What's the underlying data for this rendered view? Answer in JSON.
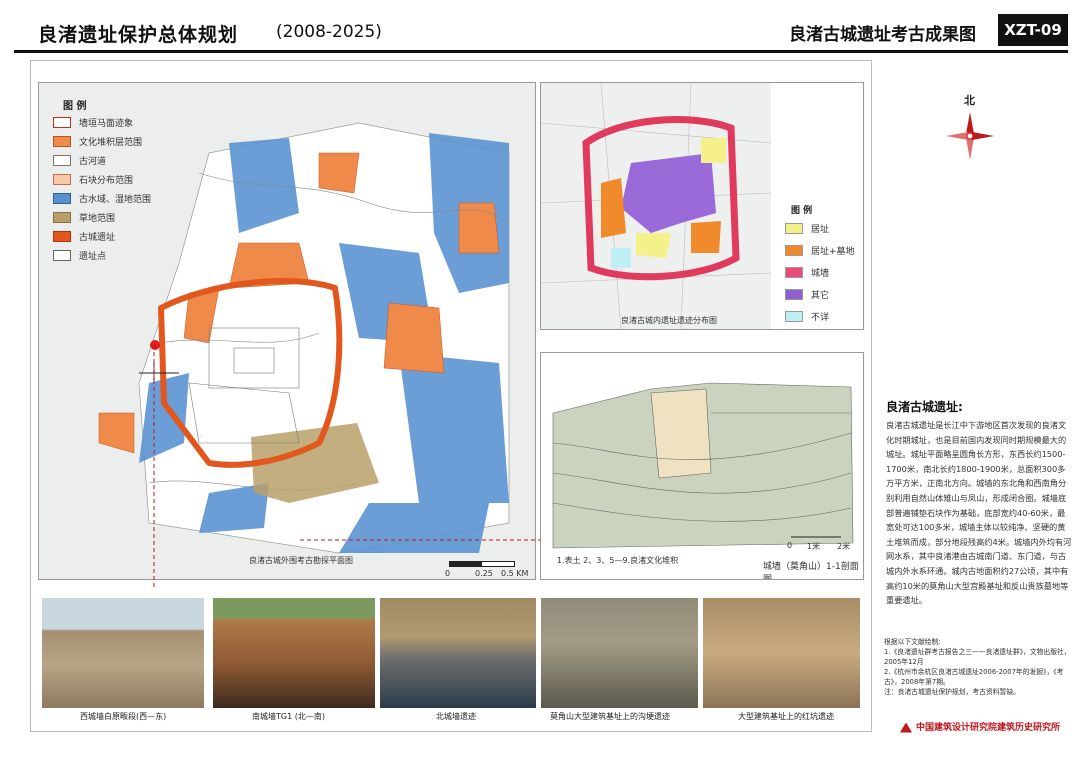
{
  "header": {
    "title": "良渚遗址保护总体规划",
    "years": "(2008-2025)",
    "subtitle": "良渚古城遗址考古成果图",
    "code": "XZT-09"
  },
  "main_map": {
    "legend_title": "图 例",
    "legend": [
      {
        "label": "墙垣马面迹象",
        "color": "#ffffff",
        "border": "#c03020"
      },
      {
        "label": "文化堆积层范围",
        "color": "#f08a4b",
        "border": "#c05020"
      },
      {
        "label": "古河道",
        "color": "#ffffff",
        "border": "#777777"
      },
      {
        "label": "石块分布范围",
        "color": "#f6c8a8",
        "border": "#c07050"
      },
      {
        "label": "古水域、湿地范围",
        "color": "#5a8fd0",
        "border": "#2a5fa0"
      },
      {
        "label": "草地范围",
        "color": "#b9a06a",
        "border": "#8a7040"
      },
      {
        "label": "古城遗址",
        "color": "#e2571e",
        "border": "#b03010"
      },
      {
        "label": "遗址点",
        "color": "#ffffff",
        "border": "#666666"
      }
    ],
    "caption": "良渚古城外围考古勘探平面图",
    "scale": [
      "0",
      "0.25",
      "0.5 KM"
    ]
  },
  "inner_map": {
    "caption": "良渚古城内遗址遗迹分布图",
    "legend_title": "图 例",
    "legend": [
      {
        "label": "居址",
        "color": "#f4f08a"
      },
      {
        "label": "居址+墓地",
        "color": "#f08a2a"
      },
      {
        "label": "城墙",
        "color": "#ec4a78"
      },
      {
        "label": "其它",
        "color": "#9060d0"
      },
      {
        "label": "不详",
        "color": "#bfeff2"
      }
    ]
  },
  "section": {
    "caption": "城墙（莫角山）1-1剖面图",
    "note": "1.表土  2、3、5—9.良渚文化堆积",
    "scale": [
      "0",
      "1米",
      "2米"
    ]
  },
  "photos": [
    {
      "caption": "西城墙白原畈段(西—东)"
    },
    {
      "caption": "南城墙TG1 (北—南)"
    },
    {
      "caption": "北城墙遗迹"
    },
    {
      "caption": "莫角山大型建筑基址上的沟埂遗迹"
    },
    {
      "caption": "大型建筑基址上的红坑遗迹"
    }
  ],
  "compass": {
    "label": "北"
  },
  "description": {
    "title": "良渚古城遗址:",
    "text": "良渚古城遗址是长江中下游地区首次发现的良渚文化时期城址，也是目前国内发现同时期规模最大的城址。城址平面略呈圆角长方形，东西长约1500-1700米，南北长约1800-1900米，总面积300多万平方米，正南北方向。城墙的东北角和西南角分别利用自然山体雉山与凤山，形成闭合圈。城墙底部普遍铺垫石块作为基础，底部宽约40-60米，最宽处可达100多米，城墙主体以较纯净、坚硬的黄土堆筑而成，部分地段残高约4米。城墙内外均有河网水系，其中良渚港由古城南门道、东门道，与古城内外水系环通。城内古地面积约27公顷，其中有高约10米的莫角山大型宫殿基址和反山贵族墓地等重要遗址。"
  },
  "references": {
    "heading": "根据以下文献绘制:",
    "items": [
      "1.《良渚遗址群考古报告之三——良渚遗址群》，文物出版社，2005年12月",
      "2.《杭州市余杭区良渚古城遗址2006-2007年的发掘》，《考古》，2008年第7期。"
    ],
    "note": "注：良渚古城遗址保护规划，考古资料暂缺。"
  },
  "org": "中国建筑设计研究院建筑历史研究所"
}
